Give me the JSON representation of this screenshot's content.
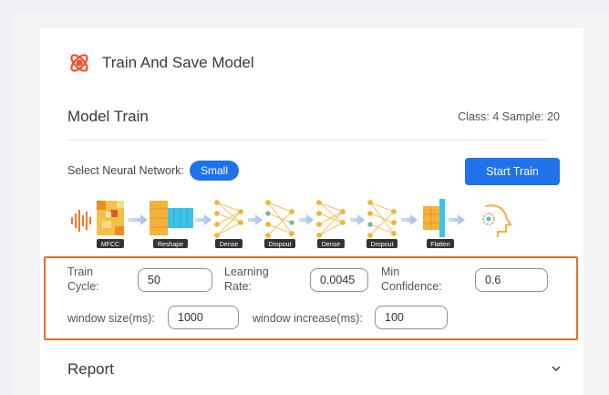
{
  "header": {
    "title": "Train And Save Model"
  },
  "model_train": {
    "title": "Model Train",
    "class_sample": "Class: 4 Sample: 20"
  },
  "network": {
    "label": "Select Neural Network:",
    "selected": "Small",
    "start_label": "Start Train"
  },
  "pipeline": {
    "layers": [
      "MFCC",
      "Reshape",
      "Dense",
      "Dropout",
      "Dense",
      "Dropout",
      "Flatten"
    ]
  },
  "params": {
    "train_cycle_label_1": "Train",
    "train_cycle_label_2": "Cycle:",
    "train_cycle_value": "50",
    "learning_rate_label_1": "Learning",
    "learning_rate_label_2": "Rate:",
    "learning_rate_value": "0.0045",
    "min_conf_label_1": "Min",
    "min_conf_label_2": "Confidence:",
    "min_conf_value": "0.6",
    "window_size_label": "window size(ms):",
    "window_size_value": "1000",
    "window_inc_label": "window increase(ms):",
    "window_inc_value": "100"
  },
  "report": {
    "title": "Report"
  },
  "colors": {
    "accent": "#1f72ea",
    "highlight": "#ef6a1f",
    "logo": "#f0522d"
  }
}
